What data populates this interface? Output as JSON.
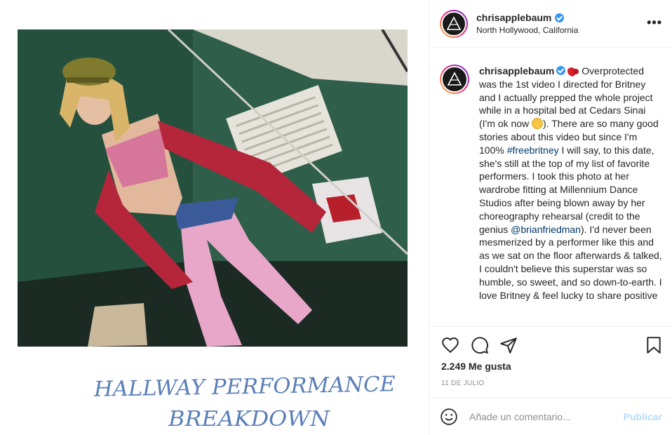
{
  "header": {
    "username": "chrisapplebaum",
    "location": "North Hollywood, California",
    "more_label": "•••"
  },
  "media": {
    "handwriting_line1": "HALLWAY PERFORMANCE",
    "handwriting_line2": "BREAKDOWN"
  },
  "comment": {
    "username": "chrisapplebaum",
    "text_1": " Overprotected was the 1st video I directed for Britney and I actually prepped the whole project while in a hospital bed at Cedars Sinai (I'm ok now ",
    "text_2": "). There are so many good stories about this video but since I'm 100% ",
    "hashtag": "#freebritney",
    "text_3": " I will say, to this date, she's still at the top of my list of favorite performers. I took this photo at her wardrobe fitting at Millennium Dance Studios after being blown away by her choreography rehearsal (credit to the genius ",
    "mention": "@brianfriedman",
    "text_4": "). I'd never been mesmerized by a performer like this and as we sat on the floor afterwards & talked, I couldn't believe this superstar was so humble, so sweet, and so down-to-earth. I love Britney & feel lucky to share positive"
  },
  "stats": {
    "likes": "2.249 Me gusta",
    "date": "11 DE JULIO"
  },
  "add_comment": {
    "placeholder": "Añade un comentario...",
    "post_label": "Publicar"
  },
  "colors": {
    "verified": "#3897f0",
    "link": "#00376b",
    "post_disabled": "#b3dbff",
    "handwriting": "#5b7fb8"
  },
  "icons": [
    "heart-icon",
    "comment-icon",
    "share-icon",
    "bookmark-icon",
    "emoji-icon",
    "more-icon",
    "verified-icon"
  ]
}
